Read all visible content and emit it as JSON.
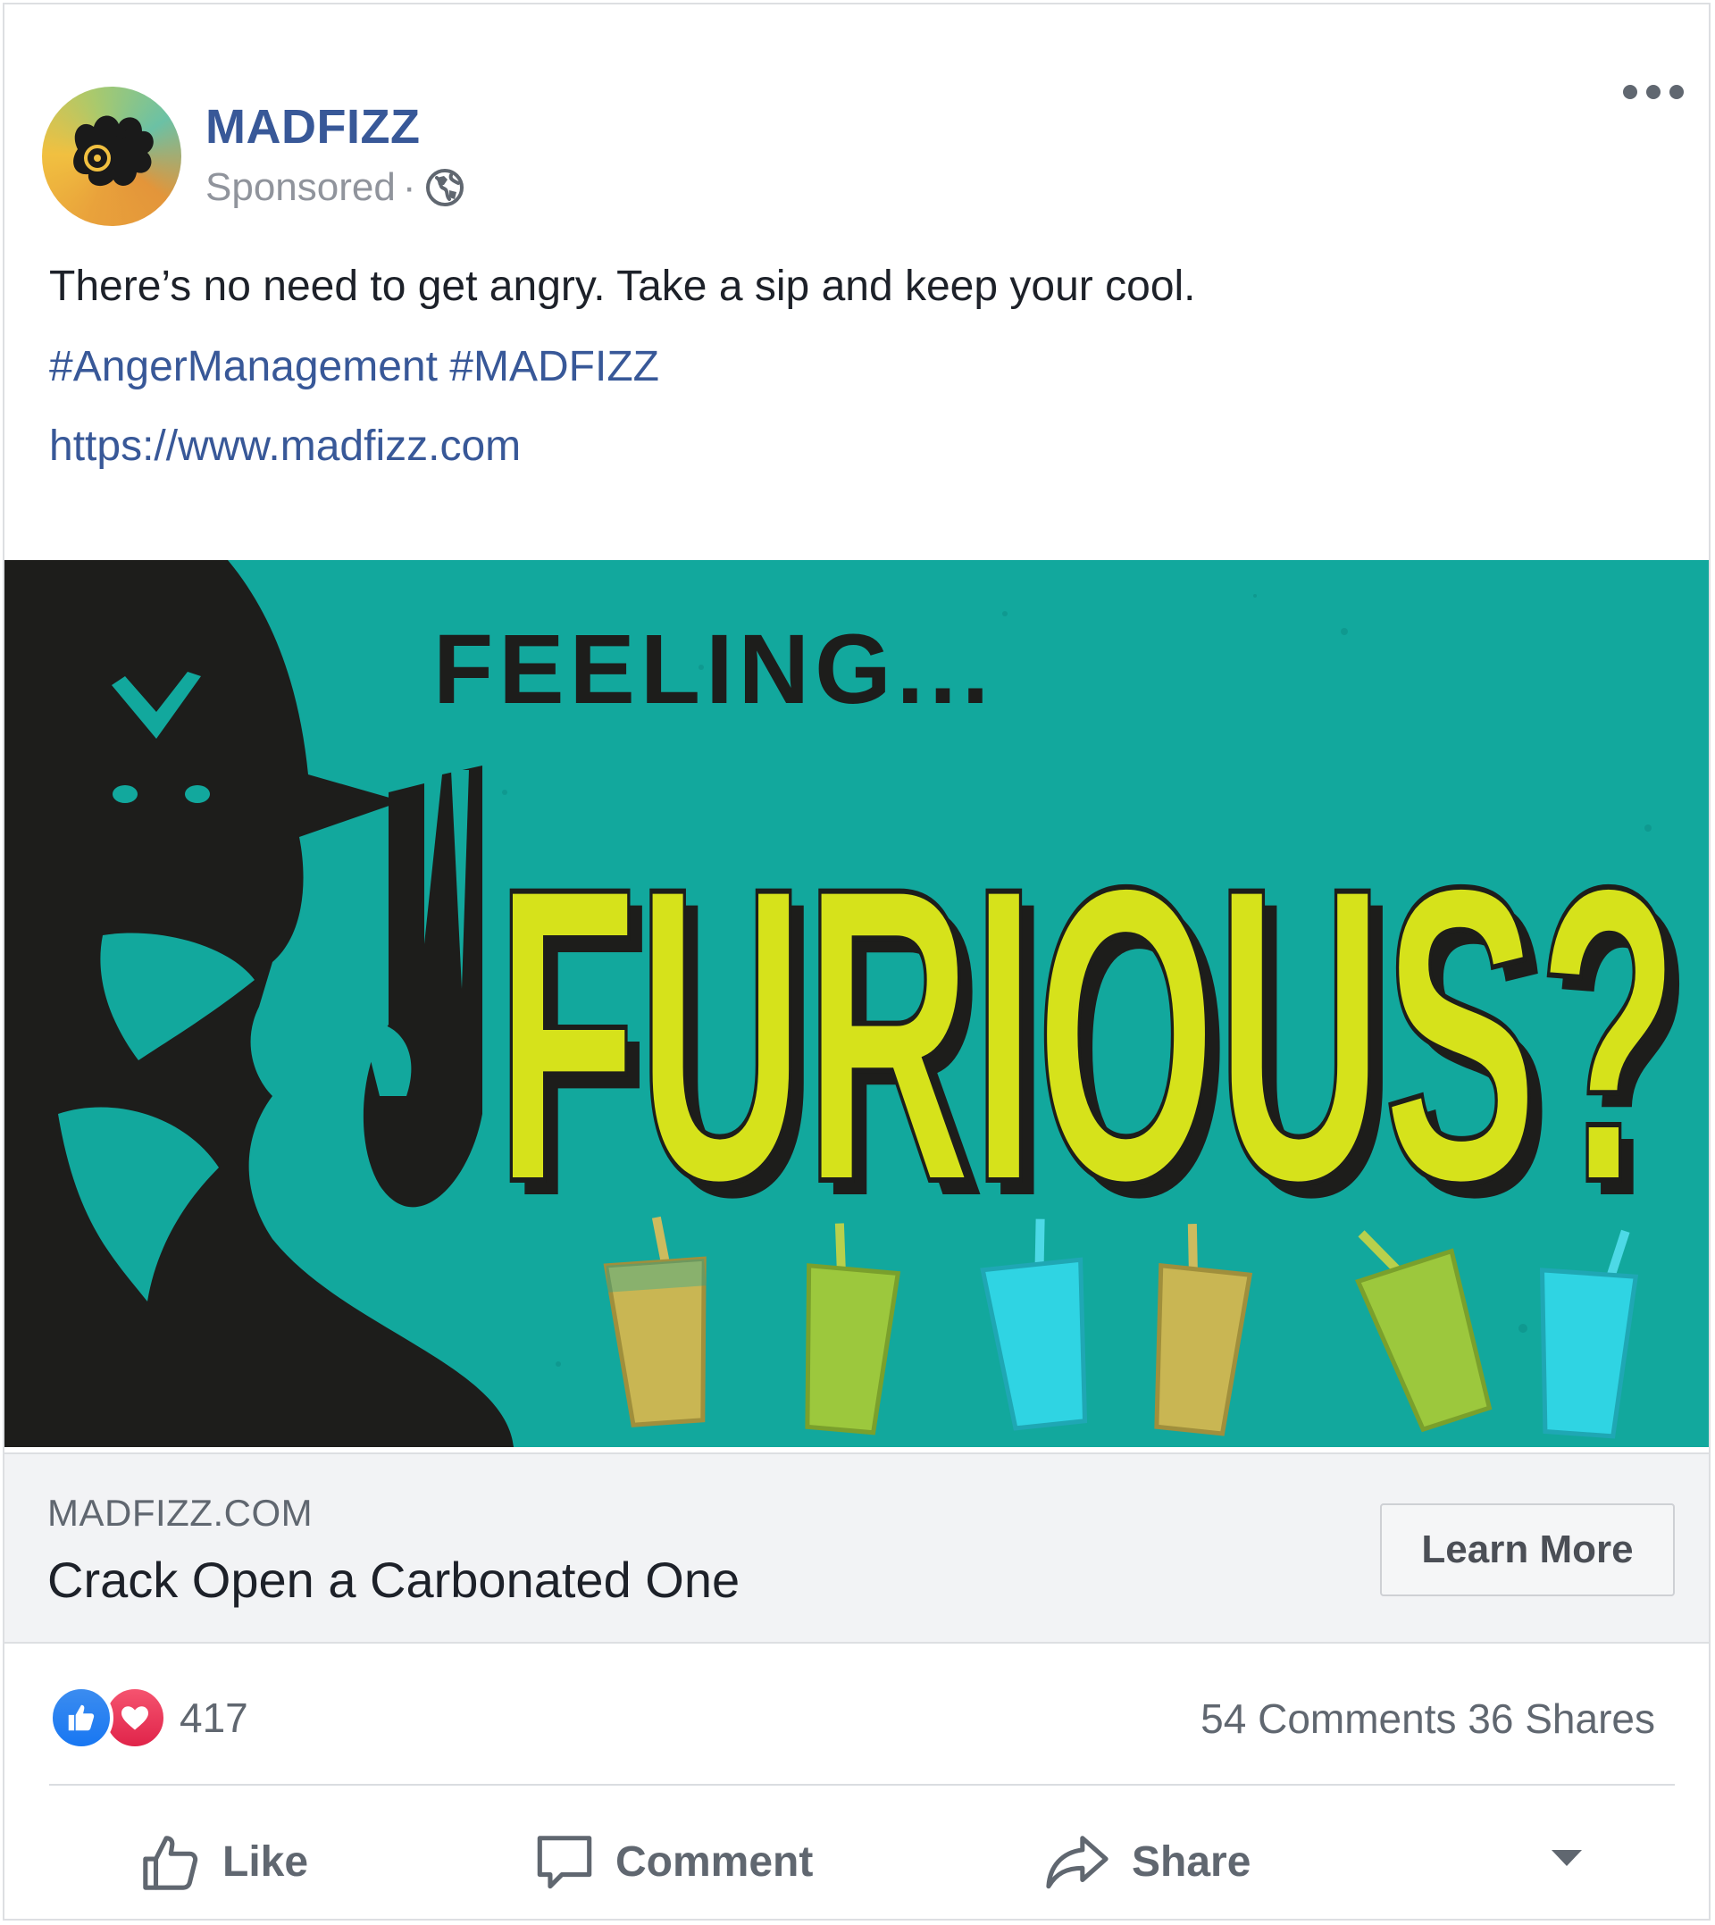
{
  "post": {
    "page_name": "MADFIZZ",
    "sponsored_label": "Sponsored",
    "separator": "·",
    "body_text": "There’s no need to get angry. Take a sip and keep your cool.",
    "hashtags": [
      "#AngerManagement",
      "#MADFIZZ"
    ],
    "url": "https://www.madfizz.com"
  },
  "ad_image": {
    "line1": "FEELING...",
    "line2": "FURIOUS?",
    "colors": {
      "background": "#12a89d",
      "silhouette": "#1d1d1b",
      "headline": "#d6e21b"
    }
  },
  "link_preview": {
    "domain": "MADFIZZ.COM",
    "headline": "Crack Open a Carbonated One",
    "cta_label": "Learn More"
  },
  "engagement": {
    "reaction_count": "417",
    "comments": "54 Comments",
    "shares": "36 Shares"
  },
  "actions": {
    "like": "Like",
    "comment": "Comment",
    "share": "Share"
  },
  "icons": [
    "more-options-icon",
    "globe-icon",
    "like-reaction-icon",
    "love-reaction-icon",
    "thumbs-up-icon",
    "comment-icon",
    "share-icon",
    "caret-down-icon"
  ]
}
